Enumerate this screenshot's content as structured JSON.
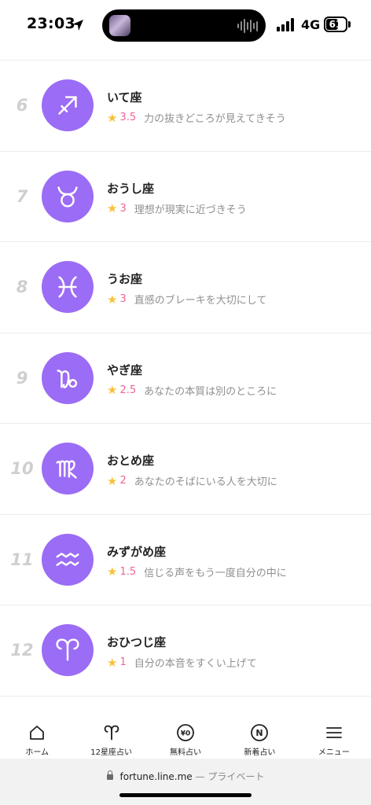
{
  "status_bar": {
    "time": "23:03",
    "network": "4G",
    "battery": "61",
    "battery_level": 0.61
  },
  "ranking": [
    {
      "rank": "6",
      "name": "いて座",
      "icon": "sagittarius-icon",
      "star": "★",
      "score": "3.5",
      "message": "力の抜きどころが見えてきそう"
    },
    {
      "rank": "7",
      "name": "おうし座",
      "icon": "taurus-icon",
      "star": "★",
      "score": "3",
      "message": "理想が現実に近づきそう"
    },
    {
      "rank": "8",
      "name": "うお座",
      "icon": "pisces-icon",
      "star": "★",
      "score": "3",
      "message": "直感のブレーキを大切にして"
    },
    {
      "rank": "9",
      "name": "やぎ座",
      "icon": "capricorn-icon",
      "star": "★",
      "score": "2.5",
      "message": "あなたの本質は別のところに"
    },
    {
      "rank": "10",
      "name": "おとめ座",
      "icon": "virgo-icon",
      "star": "★",
      "score": "2",
      "message": "あなたのそばにいる人を大切に"
    },
    {
      "rank": "11",
      "name": "みずがめ座",
      "icon": "aquarius-icon",
      "star": "★",
      "score": "1.5",
      "message": "信じる声をもう一度自分の中に"
    },
    {
      "rank": "12",
      "name": "おひつじ座",
      "icon": "aries-icon",
      "star": "★",
      "score": "1",
      "message": "自分の本音をすくい上げて"
    }
  ],
  "tab_bar": [
    {
      "label": "ホーム",
      "icon": "home-icon"
    },
    {
      "label": "12星座占い",
      "icon": "aries-icon"
    },
    {
      "label": "無料占い",
      "icon": "yen-coin-icon",
      "glyph": "¥0"
    },
    {
      "label": "新着占い",
      "icon": "new-badge-icon",
      "glyph": "N"
    },
    {
      "label": "メニュー",
      "icon": "menu-icon"
    }
  ],
  "url_bar": {
    "domain": "fortune.line.me",
    "separator": "—",
    "mode": "プライベート"
  },
  "colors": {
    "accent": "#9b6cf5",
    "score": "#f0649a",
    "star": "#f6c23b",
    "message": "#8f8f8f",
    "rank": "#cfcfcf"
  }
}
